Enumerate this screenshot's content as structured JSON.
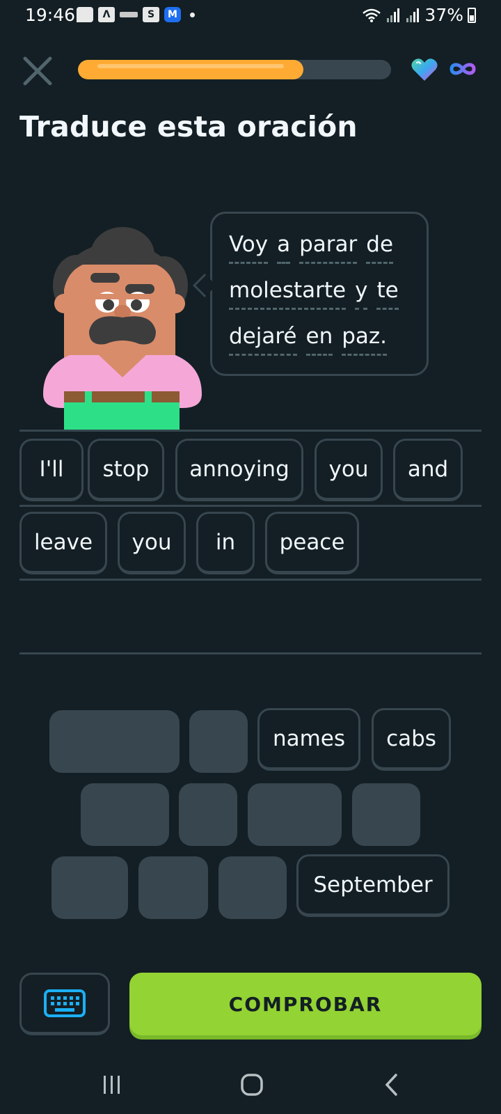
{
  "status_bar": {
    "time": "19:46",
    "battery": "37%",
    "left_icons": [
      "message-icon",
      "a-icon",
      "news-icon",
      "s-icon",
      "m-icon"
    ],
    "right_icons": [
      "wifi-icon",
      "signal-icon",
      "signal-icon",
      "battery-icon"
    ]
  },
  "progress": {
    "fraction": 0.72,
    "color": "#ffab33"
  },
  "header": {
    "title": "Traduce esta oración"
  },
  "bubble": {
    "lines": [
      [
        "Voy",
        "a",
        "parar",
        "de"
      ],
      [
        "molestarte",
        "y",
        "te"
      ],
      [
        "dejaré",
        "en",
        "paz."
      ]
    ]
  },
  "answer": {
    "row1": [
      "I'll",
      "stop",
      "annoying",
      "you",
      "and"
    ],
    "row2": [
      "leave",
      "you",
      "in",
      "peace"
    ]
  },
  "word_bank": {
    "names": "names",
    "cabs": "cabs",
    "september": "September"
  },
  "actions": {
    "check_label": "COMPROBAR"
  },
  "colors": {
    "background": "#131f24",
    "border": "#37464f",
    "accent_green": "#93d333",
    "progress_orange": "#ffab33",
    "keyboard_blue": "#1cb0f6"
  }
}
